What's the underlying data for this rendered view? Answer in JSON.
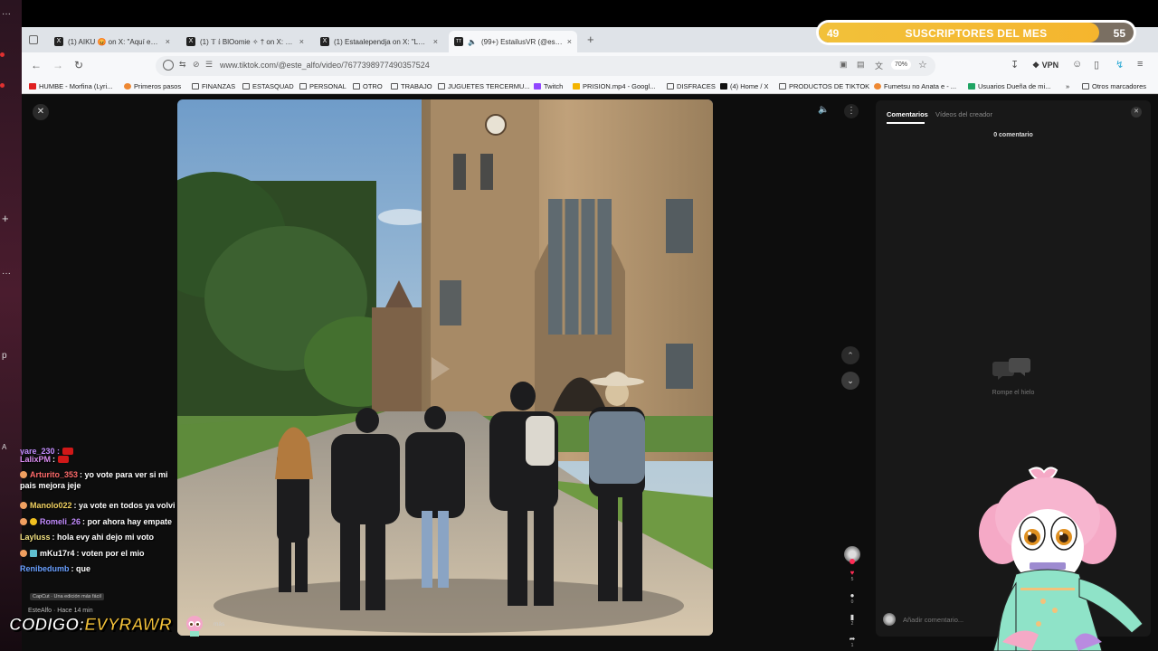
{
  "overlay": {
    "subs_current": "49",
    "subs_label": "SUSCRIPTORES DEL MES",
    "subs_goal": "55",
    "subs_progress": 0.89,
    "code_key": "CODIGO:",
    "code_value": "EVYRAWR"
  },
  "browser": {
    "tabs": [
      {
        "title": "(1) AIKU 😡 on X: \"Aquí está m",
        "favicon": "X"
      },
      {
        "title": "(1) 𝕋 𝕚 BlOomie ✧ † on X: \"Int",
        "favicon": "X"
      },
      {
        "title": "(1) Estaalependja on X: \"Le cam",
        "favicon": "X"
      },
      {
        "title": "(99+) EstailusVR (@estailus",
        "favicon": "TT"
      }
    ],
    "url": "www.tiktok.com/@este_alfo/video/7677398977490357524",
    "zoom": "70%",
    "vpn_label": "VPN",
    "bookmarks": [
      {
        "label": "HUMBE - Morfina (Lyri...",
        "icon": "yt"
      },
      {
        "label": "Primeros pasos",
        "icon": "dot"
      },
      {
        "label": "FINANZAS",
        "icon": "folder"
      },
      {
        "label": "ESTASQUAD",
        "icon": "folder"
      },
      {
        "label": "PERSONAL",
        "icon": "folder"
      },
      {
        "label": "OTRO",
        "icon": "folder"
      },
      {
        "label": "TRABAJO",
        "icon": "folder"
      },
      {
        "label": "JUGUETES TERCERMU...",
        "icon": "folder"
      },
      {
        "label": "Twitch",
        "icon": "tw"
      },
      {
        "label": "PRISION.mp4 - Googl...",
        "icon": "gd"
      },
      {
        "label": "DISFRACES",
        "icon": "folder"
      },
      {
        "label": "(4) Home / X",
        "icon": "x"
      },
      {
        "label": "PRODUCTOS DE TIKTOK",
        "icon": "folder"
      },
      {
        "label": "Fumetsu no Anata e - ...",
        "icon": "dot"
      },
      {
        "label": "Usuarios Dueña de mi...",
        "icon": "gr"
      }
    ],
    "other_bookmarks": "Otros marcadores"
  },
  "tiktok": {
    "comments_tab": "Comentarios",
    "creator_videos_tab": "Vídeos del creador",
    "comment_count": "0 comentario",
    "empty_text": "Rompe el hielo",
    "comment_placeholder": "Añadir comentario...",
    "likes": "5",
    "comments": "0",
    "saves": "2",
    "shares": "1",
    "author": "EsteAlfo · Hace 14 min",
    "capcut": "CapCut · Una edición más fácil",
    "more": "más"
  },
  "chat": [
    {
      "user": "LalixPM",
      "text": "",
      "color": "#d98cf0",
      "emote": true,
      "badge": ""
    },
    {
      "user": "Arturito_353",
      "text": "yo vote para ver si mi pais mejora jeje",
      "color": "#ff6b6b",
      "badge": "#f0a060"
    },
    {
      "user": "Manolo022",
      "text": "ya vote en todos ya volvi",
      "color": "#f0d060",
      "badge": "#f0a060"
    },
    {
      "user": "Romeli_26",
      "text": "por ahora hay empate",
      "color": "#c38cff",
      "badge": "#f0c020"
    },
    {
      "user": "Layluss",
      "text": "hola evy ahi dejo mi voto",
      "color": "#f0e080",
      "badge": ""
    },
    {
      "user": "mKu17r4",
      "text": "voten por el mio",
      "color": "#ffffff",
      "badge": "#60c0d0"
    },
    {
      "user": "Renibedumb",
      "text": "que",
      "color": "#6aa0ff",
      "badge": ""
    }
  ]
}
